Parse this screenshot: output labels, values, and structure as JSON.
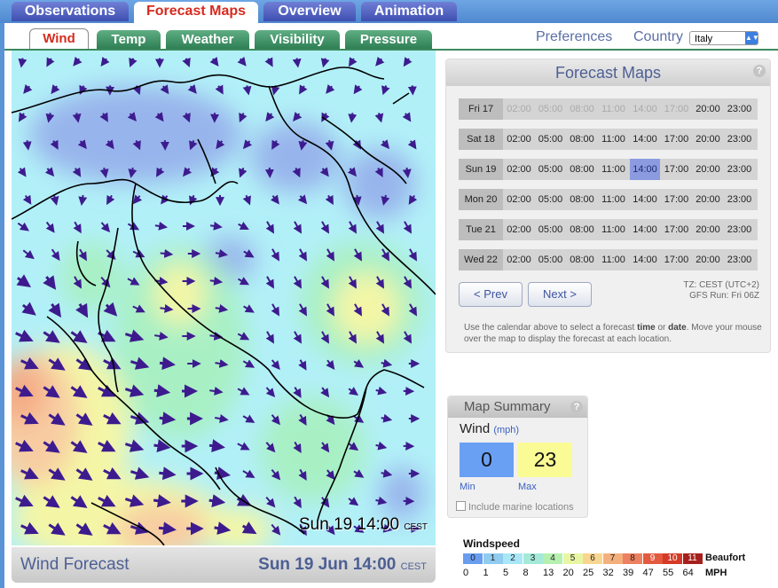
{
  "main_tabs": [
    {
      "label": "Observations",
      "active": false
    },
    {
      "label": "Forecast Maps",
      "active": true
    },
    {
      "label": "Overview",
      "active": false
    },
    {
      "label": "Animation",
      "active": false
    }
  ],
  "sub_tabs": [
    {
      "label": "Wind",
      "active": true
    },
    {
      "label": "Temp",
      "active": false
    },
    {
      "label": "Weather",
      "active": false
    },
    {
      "label": "Visibility",
      "active": false
    },
    {
      "label": "Pressure",
      "active": false
    }
  ],
  "preferences_label": "Preferences",
  "country_label": "Country",
  "country_value": "Italy",
  "map": {
    "stamp_time": "Sun 19 14:00",
    "stamp_tz": "CEST",
    "colors": {
      "calm": "#b2f0f8",
      "light": "#8fd0ea",
      "low": "#98b4ec",
      "mod": "#a8f0c4",
      "fresh": "#f4f6a6",
      "strong": "#f8cca2",
      "gale": "#f4aa84",
      "arrow": "#3d1b8e"
    }
  },
  "footer": {
    "title": "Wind Forecast",
    "datetime": "Sun 19 Jun 14:00",
    "tz": "CEST"
  },
  "forecast": {
    "title": "Forecast Maps",
    "help": "?",
    "times": [
      "02:00",
      "05:00",
      "08:00",
      "11:00",
      "14:00",
      "17:00",
      "20:00",
      "23:00"
    ],
    "days": [
      {
        "label": "Fri 17",
        "available": [
          false,
          false,
          false,
          false,
          false,
          false,
          true,
          true
        ]
      },
      {
        "label": "Sat 18",
        "available": [
          true,
          true,
          true,
          true,
          true,
          true,
          true,
          true
        ]
      },
      {
        "label": "Sun 19",
        "available": [
          true,
          true,
          true,
          true,
          true,
          true,
          true,
          true
        ],
        "selected": "14:00"
      },
      {
        "label": "Mon 20",
        "available": [
          true,
          true,
          true,
          true,
          true,
          true,
          true,
          true
        ]
      },
      {
        "label": "Tue 21",
        "available": [
          true,
          true,
          true,
          true,
          true,
          true,
          true,
          true
        ]
      },
      {
        "label": "Wed 22",
        "available": [
          true,
          true,
          true,
          true,
          true,
          true,
          true,
          true
        ]
      }
    ],
    "prev_label": "< Prev",
    "next_label": "Next >",
    "tz_info": "TZ: CEST (UTC+2)",
    "gfs_info": "GFS Run: Fri 06Z",
    "help_text_1": "Use the calendar above to select a forecast ",
    "help_bold_1": "time",
    "help_text_2": " or ",
    "help_bold_2": "date",
    "help_text_3": ". Move your mouse over the map to display the forecast at each location."
  },
  "summary": {
    "title": "Map Summary",
    "help": "?",
    "variable": "Wind",
    "unit": "(mph)",
    "min_value": "0",
    "max_value": "23",
    "min_label": "Min",
    "max_label": "Max",
    "marine_label": "Include marine locations",
    "min_color": "#6aa0f4",
    "max_color": "#fbfb96"
  },
  "legend": {
    "title": "Windspeed",
    "beaufort_label": "Beaufort",
    "mph_label": "MPH",
    "beaufort": [
      "0",
      "1",
      "2",
      "3",
      "4",
      "5",
      "6",
      "7",
      "8",
      "9",
      "10",
      "11"
    ],
    "colors": [
      "#6a9df0",
      "#90cbf0",
      "#a9e7f6",
      "#a5e9d8",
      "#b6f0b0",
      "#e8f6a4",
      "#f8d690",
      "#f4b07c",
      "#ec8060",
      "#e45a3e",
      "#d43a26",
      "#a5201c"
    ],
    "mph": [
      "0",
      "1",
      "5",
      "8",
      "13",
      "20",
      "25",
      "32",
      "39",
      "47",
      "55",
      "64"
    ]
  }
}
